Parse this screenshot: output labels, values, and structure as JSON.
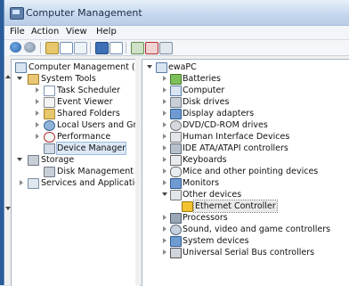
{
  "window": {
    "title": "Computer Management"
  },
  "menu": {
    "items": [
      "File",
      "Action",
      "View",
      "Help"
    ]
  },
  "toolbar": {
    "buttons": [
      "back-icon",
      "forward-icon",
      "up-icon",
      "show-hide-tree-icon",
      "export-icon",
      "help-icon",
      "properties-icon",
      "update-driver-icon",
      "uninstall-icon",
      "scan-hardware-icon"
    ]
  },
  "left_tree": {
    "root": "Computer Management (Local",
    "system_tools": "System Tools",
    "task_scheduler": "Task Scheduler",
    "event_viewer": "Event Viewer",
    "shared_folders": "Shared Folders",
    "local_users": "Local Users and Groups",
    "performance": "Performance",
    "device_manager": "Device Manager",
    "storage": "Storage",
    "disk_management": "Disk Management",
    "services": "Services and Applications"
  },
  "device_tree": {
    "computer_name": "ewaPC",
    "categories": [
      "Batteries",
      "Computer",
      "Disk drives",
      "Display adapters",
      "DVD/CD-ROM drives",
      "Human Interface Devices",
      "IDE ATA/ATAPI controllers",
      "Keyboards",
      "Mice and other pointing devices",
      "Monitors",
      "Other devices",
      "Processors",
      "Sound, video and game controllers",
      "System devices",
      "Universal Serial Bus controllers"
    ],
    "other_devices_child": "Ethernet Controller"
  },
  "colors": {
    "title_bar": "#c7d8ee",
    "selection": "#dce8f6",
    "warning": "#f2c230"
  }
}
